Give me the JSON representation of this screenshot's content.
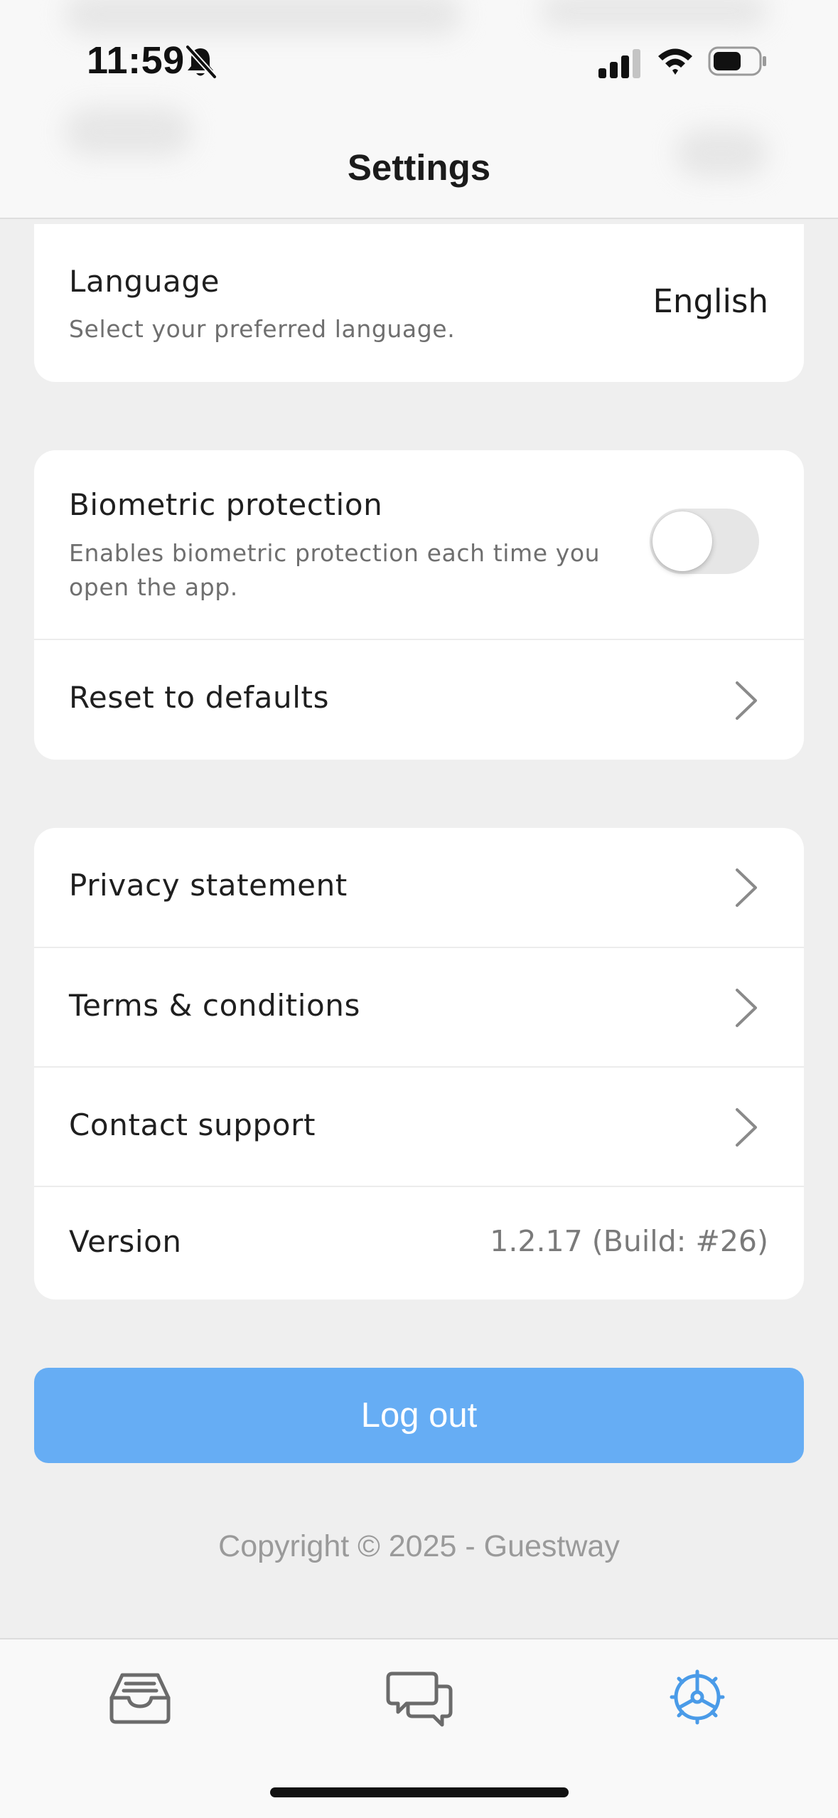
{
  "status_bar": {
    "time": "11:59"
  },
  "header": {
    "title": "Settings"
  },
  "language_card": {
    "title": "Language",
    "description": "Select your preferred language.",
    "value": "English"
  },
  "security_card": {
    "biometric": {
      "title": "Biometric protection",
      "description": "Enables biometric protection each time you open the app.",
      "enabled": false
    },
    "reset": {
      "title": "Reset to defaults"
    }
  },
  "info_card": {
    "privacy": "Privacy statement",
    "terms": "Terms & conditions",
    "support": "Contact support",
    "version_label": "Version",
    "version_value": "1.2.17 (Build: #26)"
  },
  "logout_label": "Log out",
  "copyright": "Copyright © 2025 - Guestway",
  "tabbar": {
    "tabs": [
      {
        "icon": "inbox-icon",
        "active": false
      },
      {
        "icon": "chat-bubbles-icon",
        "active": false
      },
      {
        "icon": "settings-gear-icon",
        "active": true
      }
    ]
  },
  "colors": {
    "accent": "#66adf4",
    "active_tab": "#4a9be8",
    "background": "#efefef"
  }
}
